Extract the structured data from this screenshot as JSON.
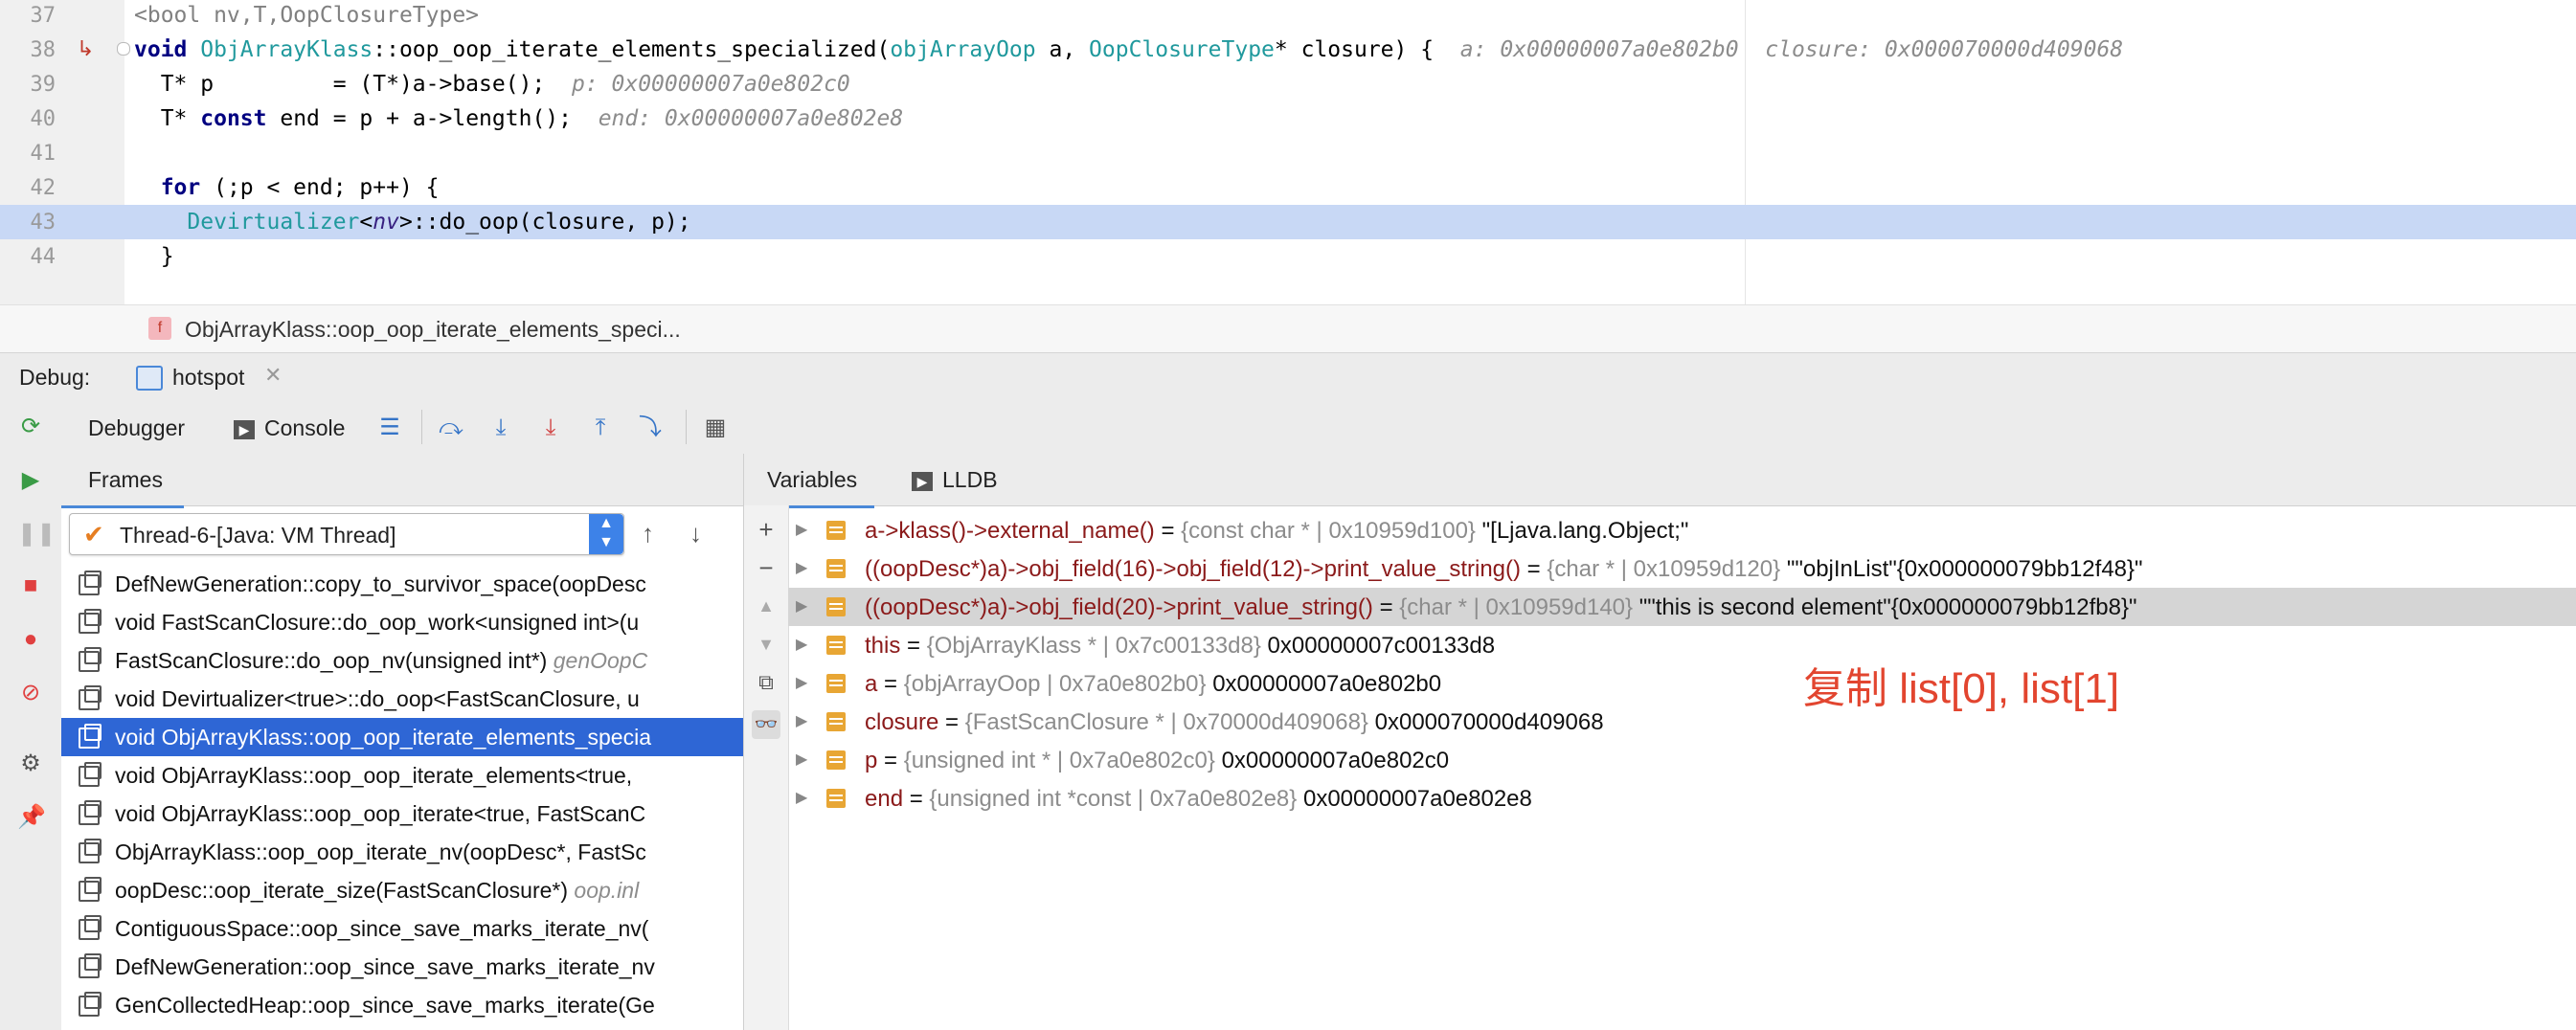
{
  "editor": {
    "lines": [
      {
        "num": "37",
        "parts": [
          {
            "t": "<bool nv,T,OopClosureType>",
            "c": "ann"
          }
        ]
      },
      {
        "num": "38",
        "parts": [
          {
            "t": "void ",
            "c": "kw"
          },
          {
            "t": "ObjArrayKlass",
            "c": "typ"
          },
          {
            "t": "::oop_oop_iterate_elements_specialized(",
            "c": "fn"
          },
          {
            "t": "objArrayOop",
            "c": "typ"
          },
          {
            "t": " a, ",
            "c": "fn"
          },
          {
            "t": "OopClosureType",
            "c": "typ"
          },
          {
            "t": "* closure) {  ",
            "c": "fn"
          },
          {
            "t": "a: 0x00000007a0e802b0  closure: 0x000070000d409068",
            "c": "hint"
          }
        ]
      },
      {
        "num": "39",
        "parts": [
          {
            "t": "  T* p         = (T*)a->base();  ",
            "c": "fn"
          },
          {
            "t": "p: 0x00000007a0e802c0",
            "c": "hint"
          }
        ]
      },
      {
        "num": "40",
        "parts": [
          {
            "t": "  T* ",
            "c": "fn"
          },
          {
            "t": "const",
            "c": "kw"
          },
          {
            "t": " end = p + a->length();  ",
            "c": "fn"
          },
          {
            "t": "end: 0x00000007a0e802e8",
            "c": "hint"
          }
        ]
      },
      {
        "num": "41",
        "parts": []
      },
      {
        "num": "42",
        "parts": [
          {
            "t": "  ",
            "c": "fn"
          },
          {
            "t": "for",
            "c": "kw"
          },
          {
            "t": " (;p < end; p++) {",
            "c": "fn"
          }
        ]
      },
      {
        "num": "43",
        "parts": [
          {
            "t": "    ",
            "c": "fn"
          },
          {
            "t": "Devirtualizer",
            "c": "typ"
          },
          {
            "t": "<",
            "c": "fn"
          },
          {
            "t": "nv",
            "c": "gen"
          },
          {
            "t": ">::do_oop(closure, p);",
            "c": "fn"
          }
        ]
      },
      {
        "num": "44",
        "parts": [
          {
            "t": "  }",
            "c": "fn"
          }
        ]
      }
    ],
    "breadcrumb": "ObjArrayKlass::oop_oop_iterate_elements_speci...",
    "breadcrumb_badge": "f"
  },
  "debug": {
    "label": "Debug:",
    "session_tab": "hotspot",
    "tabs": {
      "debugger": "Debugger",
      "console": "Console"
    },
    "frames_tab": "Frames",
    "variables_tab": "Variables",
    "lldb_tab": "LLDB",
    "thread": "Thread-6-[Java: VM Thread]"
  },
  "frames": [
    {
      "text": "DefNewGeneration::copy_to_survivor_space(oopDesc",
      "hint": ""
    },
    {
      "text": "void FastScanClosure::do_oop_work<unsigned int>(u",
      "hint": ""
    },
    {
      "text": "FastScanClosure::do_oop_nv(unsigned int*) ",
      "hint": "genOopC"
    },
    {
      "text": "void Devirtualizer<true>::do_oop<FastScanClosure, u",
      "hint": ""
    },
    {
      "text": "void ObjArrayKlass::oop_oop_iterate_elements_specia",
      "hint": ""
    },
    {
      "text": "void ObjArrayKlass::oop_oop_iterate_elements<true, ",
      "hint": ""
    },
    {
      "text": "void ObjArrayKlass::oop_oop_iterate<true, FastScanC",
      "hint": ""
    },
    {
      "text": "ObjArrayKlass::oop_oop_iterate_nv(oopDesc*, FastSc",
      "hint": ""
    },
    {
      "text": "oopDesc::oop_iterate_size(FastScanClosure*) ",
      "hint": "oop.inl"
    },
    {
      "text": "ContiguousSpace::oop_since_save_marks_iterate_nv(",
      "hint": ""
    },
    {
      "text": "DefNewGeneration::oop_since_save_marks_iterate_nv",
      "hint": ""
    },
    {
      "text": "GenCollectedHeap::oop_since_save_marks_iterate(Ge",
      "hint": ""
    }
  ],
  "selected_frame": 4,
  "variables": [
    {
      "name": "a->klass()->external_name()",
      "type": "{const char * | 0x10959d100}",
      "value": "\"[Ljava.lang.Object;\""
    },
    {
      "name": "((oopDesc*)a)->obj_field(16)->obj_field(12)->print_value_string()",
      "type": "{char * | 0x10959d120}",
      "value": "\"\"objInList\"{0x000000079bb12f48}\""
    },
    {
      "name": "((oopDesc*)a)->obj_field(20)->print_value_string()",
      "type": "{char * | 0x10959d140}",
      "value": "\"\"this is second element\"{0x000000079bb12fb8}\""
    },
    {
      "name": "this",
      "type": "{ObjArrayKlass * | 0x7c00133d8}",
      "value": "0x00000007c00133d8"
    },
    {
      "name": "a",
      "type": "{objArrayOop | 0x7a0e802b0}",
      "value": "0x00000007a0e802b0"
    },
    {
      "name": "closure",
      "type": "{FastScanClosure * | 0x70000d409068}",
      "value": "0x000070000d409068"
    },
    {
      "name": "p",
      "type": "{unsigned int * | 0x7a0e802c0}",
      "value": "0x00000007a0e802c0"
    },
    {
      "name": "end",
      "type": "{unsigned int *const | 0x7a0e802e8}",
      "value": "0x00000007a0e802e8"
    }
  ],
  "selected_variable": 2,
  "annotation": "复制 list[0], list[1]",
  "colors": {
    "accent": "#2e66d5",
    "note": "#e2452f",
    "highlight": "#c8d8f5"
  }
}
